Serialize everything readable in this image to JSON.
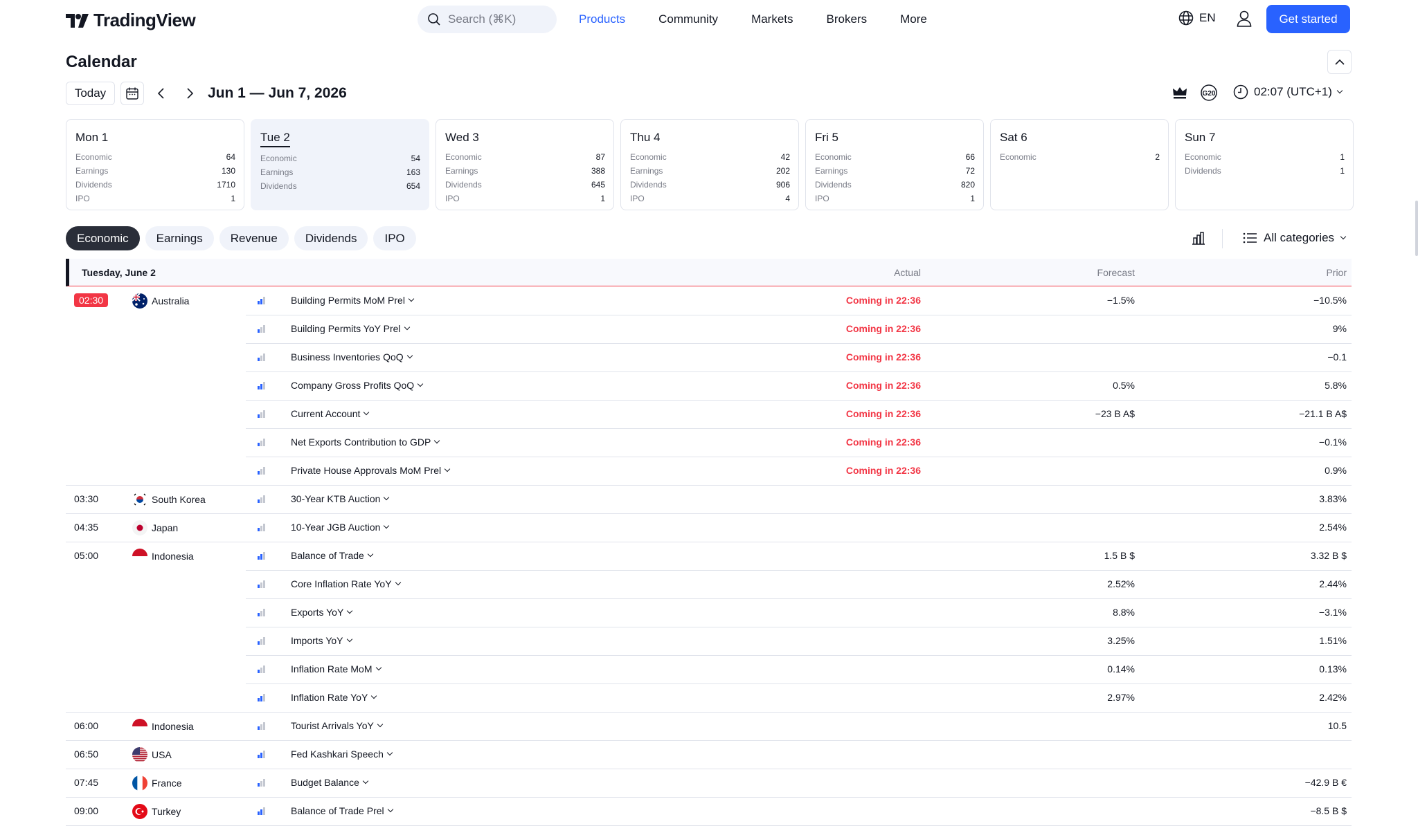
{
  "brand": {
    "name": "TradingView"
  },
  "header": {
    "search_placeholder": "Search (⌘K)",
    "nav": [
      "Products",
      "Community",
      "Markets",
      "Brokers",
      "More"
    ],
    "lang": "EN",
    "cta": "Get started"
  },
  "toolbar": {
    "title": "Calendar",
    "today": "Today",
    "range": "Jun 1 — Jun 7, 2026",
    "g20": "G20",
    "timezone": "02:07 (UTC+1)"
  },
  "days": [
    {
      "name": "Mon 1",
      "stats": [
        {
          "k": "Economic",
          "v": "64"
        },
        {
          "k": "Earnings",
          "v": "130"
        },
        {
          "k": "Dividends",
          "v": "1710"
        },
        {
          "k": "IPO",
          "v": "1"
        }
      ]
    },
    {
      "name": "Tue 2",
      "selected": true,
      "stats": [
        {
          "k": "Economic",
          "v": "54"
        },
        {
          "k": "Earnings",
          "v": "163"
        },
        {
          "k": "Dividends",
          "v": "654"
        }
      ]
    },
    {
      "name": "Wed 3",
      "stats": [
        {
          "k": "Economic",
          "v": "87"
        },
        {
          "k": "Earnings",
          "v": "388"
        },
        {
          "k": "Dividends",
          "v": "645"
        },
        {
          "k": "IPO",
          "v": "1"
        }
      ]
    },
    {
      "name": "Thu 4",
      "stats": [
        {
          "k": "Economic",
          "v": "42"
        },
        {
          "k": "Earnings",
          "v": "202"
        },
        {
          "k": "Dividends",
          "v": "906"
        },
        {
          "k": "IPO",
          "v": "4"
        }
      ]
    },
    {
      "name": "Fri 5",
      "stats": [
        {
          "k": "Economic",
          "v": "66"
        },
        {
          "k": "Earnings",
          "v": "72"
        },
        {
          "k": "Dividends",
          "v": "820"
        },
        {
          "k": "IPO",
          "v": "1"
        }
      ]
    },
    {
      "name": "Sat 6",
      "stats": [
        {
          "k": "Economic",
          "v": "2"
        }
      ]
    },
    {
      "name": "Sun 7",
      "stats": [
        {
          "k": "Economic",
          "v": "1"
        },
        {
          "k": "Dividends",
          "v": "1"
        }
      ]
    }
  ],
  "tabs": [
    {
      "label": "Economic",
      "active": true
    },
    {
      "label": "Earnings"
    },
    {
      "label": "Revenue"
    },
    {
      "label": "Dividends"
    },
    {
      "label": "IPO"
    }
  ],
  "filter": {
    "categories": "All categories"
  },
  "table": {
    "date_header": "Tuesday, June 2",
    "columns": {
      "actual": "Actual",
      "forecast": "Forecast",
      "prior": "Prior"
    },
    "rows": [
      {
        "time": "02:30",
        "live": true,
        "country": "Australia",
        "flag": "au",
        "imp": 2,
        "event": "Building Permits MoM Prel",
        "actual": "Coming in 22:36",
        "forecast": "−1.5%",
        "prior": "−10.5%"
      },
      {
        "event": "Building Permits YoY Prel",
        "imp": 1,
        "actual": "Coming in 22:36",
        "forecast": "",
        "prior": "9%"
      },
      {
        "event": "Business Inventories QoQ",
        "imp": 1,
        "actual": "Coming in 22:36",
        "forecast": "",
        "prior": "−0.1"
      },
      {
        "event": "Company Gross Profits QoQ",
        "imp": 2,
        "actual": "Coming in 22:36",
        "forecast": "0.5%",
        "prior": "5.8%"
      },
      {
        "event": "Current Account",
        "imp": 1,
        "actual": "Coming in 22:36",
        "forecast": "−23 B A$",
        "prior": "−21.1 B A$"
      },
      {
        "event": "Net Exports Contribution to GDP",
        "imp": 1,
        "actual": "Coming in 22:36",
        "forecast": "",
        "prior": "−0.1%"
      },
      {
        "event": "Private House Approvals MoM Prel",
        "imp": 1,
        "actual": "Coming in 22:36",
        "forecast": "",
        "prior": "0.9%"
      },
      {
        "time": "03:30",
        "country": "South Korea",
        "flag": "kr",
        "imp": 1,
        "event": "30-Year KTB Auction",
        "actual": "",
        "forecast": "",
        "prior": "3.83%"
      },
      {
        "time": "04:35",
        "country": "Japan",
        "flag": "jp",
        "imp": 1,
        "event": "10-Year JGB Auction",
        "actual": "",
        "forecast": "",
        "prior": "2.54%"
      },
      {
        "time": "05:00",
        "country": "Indonesia",
        "flag": "id",
        "imp": 2,
        "event": "Balance of Trade",
        "actual": "",
        "forecast": "1.5 B $",
        "prior": "3.32 B $"
      },
      {
        "event": "Core Inflation Rate YoY",
        "imp": 1,
        "actual": "",
        "forecast": "2.52%",
        "prior": "2.44%"
      },
      {
        "event": "Exports YoY",
        "imp": 1,
        "actual": "",
        "forecast": "8.8%",
        "prior": "−3.1%"
      },
      {
        "event": "Imports YoY",
        "imp": 1,
        "actual": "",
        "forecast": "3.25%",
        "prior": "1.51%"
      },
      {
        "event": "Inflation Rate MoM",
        "imp": 1,
        "actual": "",
        "forecast": "0.14%",
        "prior": "0.13%"
      },
      {
        "event": "Inflation Rate YoY",
        "imp": 2,
        "actual": "",
        "forecast": "2.97%",
        "prior": "2.42%"
      },
      {
        "time": "06:00",
        "country": "Indonesia",
        "flag": "id",
        "imp": 1,
        "event": "Tourist Arrivals YoY",
        "actual": "",
        "forecast": "",
        "prior": "10.5"
      },
      {
        "time": "06:50",
        "country": "USA",
        "flag": "us",
        "imp": 2,
        "event": "Fed Kashkari Speech",
        "actual": "",
        "forecast": "",
        "prior": ""
      },
      {
        "time": "07:45",
        "country": "France",
        "flag": "fr",
        "imp": 1,
        "event": "Budget Balance",
        "actual": "",
        "forecast": "",
        "prior": "−42.9 B €"
      },
      {
        "time": "09:00",
        "country": "Turkey",
        "flag": "tr",
        "imp": 2,
        "event": "Balance of Trade Prel",
        "actual": "",
        "forecast": "",
        "prior": "−8.5 B $"
      }
    ]
  },
  "colors": {
    "accent": "#2962ff",
    "alert": "#f23645",
    "text": "#131722",
    "muted": "#787b86",
    "border": "#e0e3eb"
  }
}
